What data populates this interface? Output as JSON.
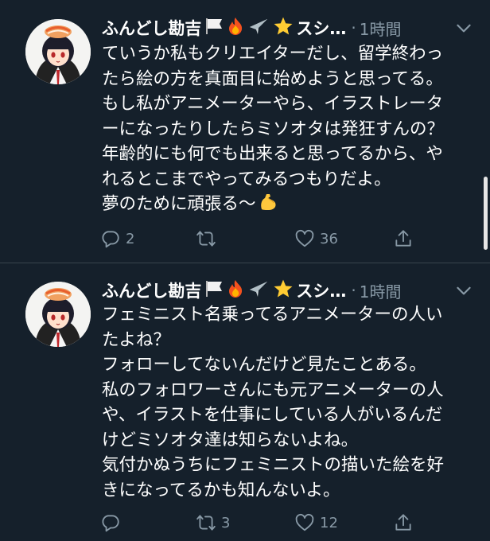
{
  "tweets": [
    {
      "display_name": "ふんどし勘吉",
      "name_tail": "スシ…",
      "dot": "·",
      "time": "1時間",
      "lines": [
        "ていうか私もクリエイターだし、留学終わっ",
        "たら絵の方を真面目に始めようと思ってる。",
        "もし私がアニメーターやら、イラストレータ",
        "ーになったりしたらミソオタは発狂すんの？",
        "年齢的にも何でも出来ると思ってるから、や",
        "れるとこまでやってみるつもりだよ。",
        "夢のために頑張る〜"
      ],
      "reply_count": "2",
      "retweet_count": "",
      "like_count": "36"
    },
    {
      "display_name": "ふんどし勘吉",
      "name_tail": "スシ…",
      "dot": "·",
      "time": "1時間",
      "lines": [
        "フェミニスト名乗ってるアニメーターの人い",
        "たよね？",
        "フォローしてないんだけど見たことある。",
        "私のフォロワーさんにも元アニメーターの人",
        "や、イラストを仕事にしている人がいるんだ",
        "けどミソオタ達は知らないよね。",
        "気付かぬうちにフェミニストの描いた絵を好",
        "きになってるかも知んないよ。"
      ],
      "reply_count": "",
      "retweet_count": "3",
      "like_count": "12"
    }
  ],
  "icons": {
    "reply": "reply-icon",
    "retweet": "retweet-icon",
    "like": "heart-icon",
    "share": "share-icon",
    "more": "chevron-down-icon",
    "flex": "flexed-biceps-emoji"
  },
  "colors": {
    "background": "#15202b",
    "text": "#ffffff",
    "secondary": "#8899a6",
    "divider": "#38444d"
  }
}
